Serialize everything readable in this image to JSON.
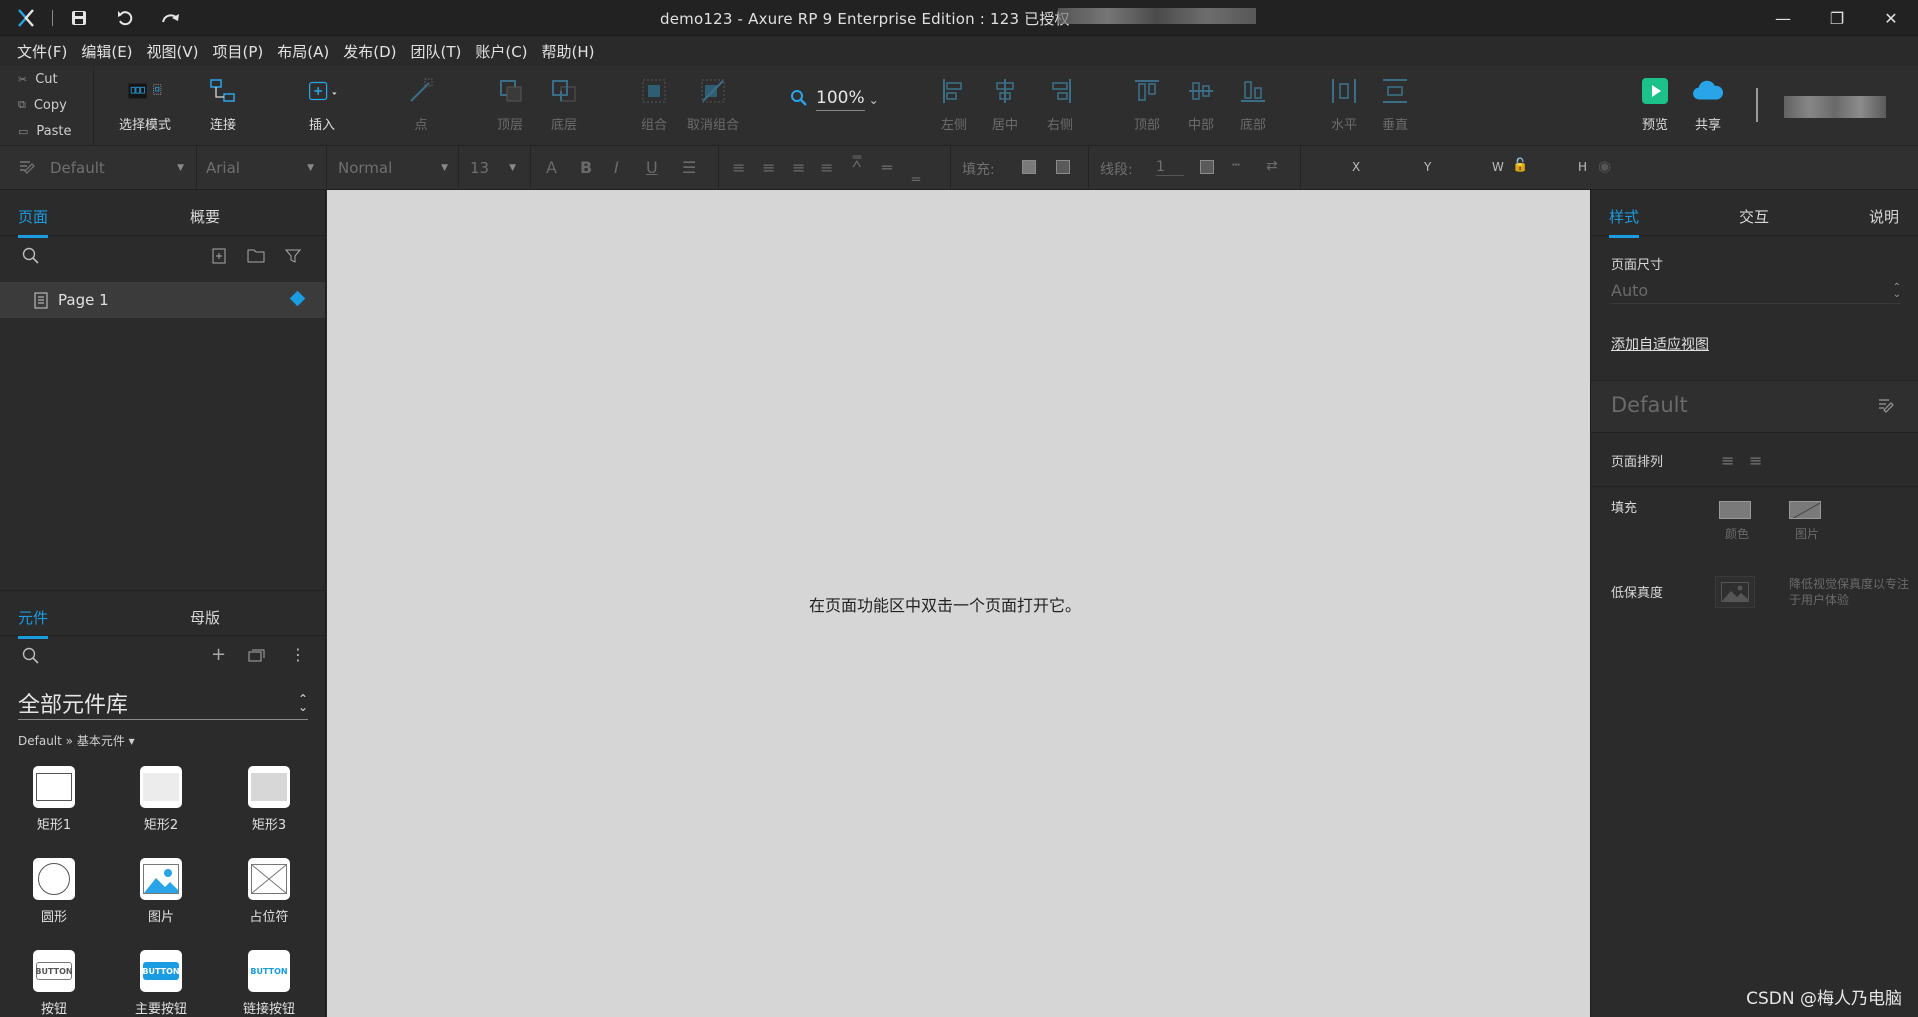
{
  "titlebar": {
    "title": "demo123 - Axure RP 9 Enterprise Edition : 123 已授权",
    "minimize": "—",
    "maximize": "❐",
    "close": "✕"
  },
  "menu": [
    "文件(F)",
    "编辑(E)",
    "视图(V)",
    "项目(P)",
    "布局(A)",
    "发布(D)",
    "团队(T)",
    "账户(C)",
    "帮助(H)"
  ],
  "clipboard": {
    "cut": "Cut",
    "copy": "Copy",
    "paste": "Paste"
  },
  "toolbar": {
    "select_mode": "选择模式",
    "connect": "连接",
    "insert": "插入",
    "point": "点",
    "top_layer": "顶层",
    "bottom_layer": "底层",
    "group": "组合",
    "ungroup": "取消组合",
    "zoom": "100%",
    "align_left": "左侧",
    "align_center": "居中",
    "align_right": "右侧",
    "align_top": "顶部",
    "align_middle": "中部",
    "align_bottom": "底部",
    "dist_h": "水平",
    "dist_v": "垂直",
    "preview": "预览",
    "share": "共享"
  },
  "formatbar": {
    "style": "Default",
    "font": "Arial",
    "weight": "Normal",
    "size": "13",
    "fill_label": "填充:",
    "line_label": "线段:",
    "line_value": "1",
    "x": "X",
    "y": "Y",
    "w": "W",
    "h": "H"
  },
  "left": {
    "tab_pages": "页面",
    "tab_outline": "概要",
    "page1": "Page 1",
    "tab_widgets": "元件",
    "tab_masters": "母版",
    "library": "全部元件库",
    "breadcrumb": "Default » 基本元件 ▾",
    "widgets": [
      "矩形1",
      "矩形2",
      "矩形3",
      "圆形",
      "图片",
      "占位符",
      "按钮",
      "主要按钮",
      "链接按钮"
    ],
    "button_text": "BUTTON"
  },
  "canvas": {
    "hint": "在页面功能区中双击一个页面打开它。"
  },
  "right": {
    "tab_style": "样式",
    "tab_interact": "交互",
    "tab_notes": "说明",
    "page_size_label": "页面尺寸",
    "page_size_value": "Auto",
    "adaptive_link": "添加自适应视图",
    "style_name": "Default",
    "page_align": "页面排列",
    "fill": "填充",
    "fill_color": "颜色",
    "fill_image": "图片",
    "low_fidelity": "低保真度",
    "low_fidelity_desc": "降低视觉保真度以专注于用户体验"
  },
  "watermark": "CSDN @梅人乃电脑",
  "colors": {
    "accent": "#1a9ce2",
    "preview_green": "#1cc28a",
    "share_blue": "#2aa4e8"
  }
}
